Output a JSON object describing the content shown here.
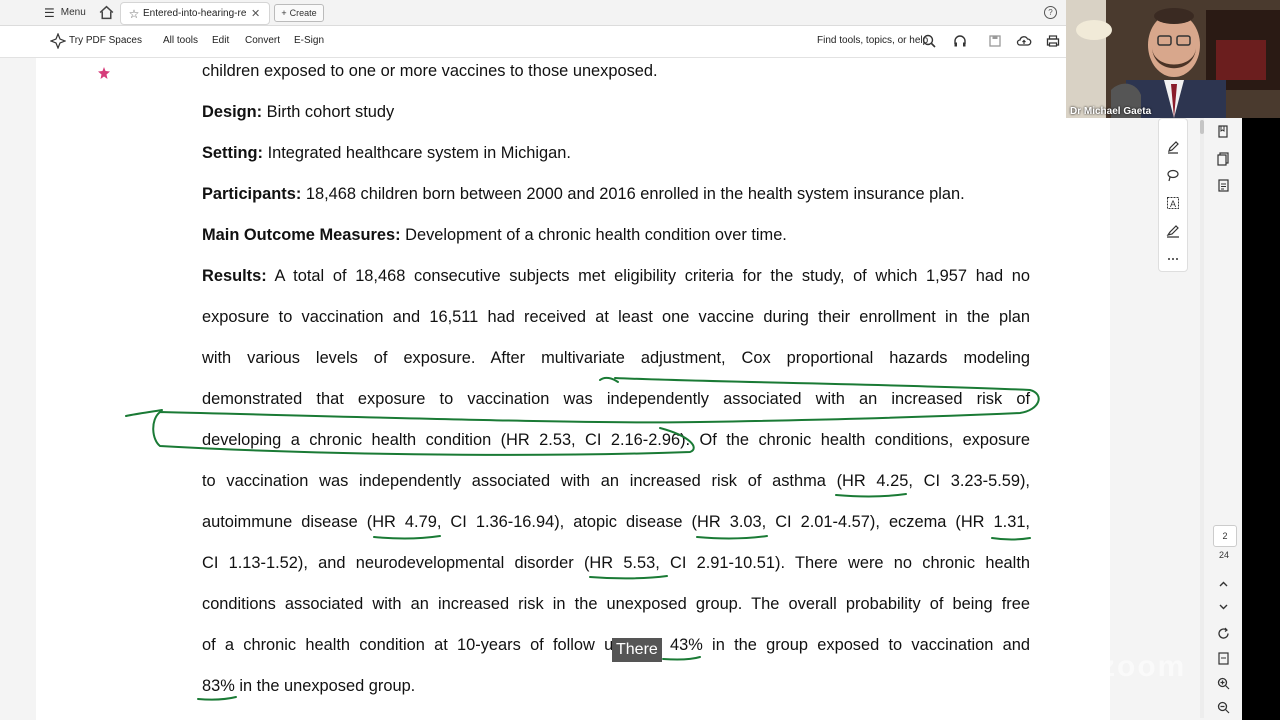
{
  "browser": {
    "menu_label": "Menu",
    "tab_title": "Entered-into-hearing-re...",
    "create_label": "Create",
    "help_icon": "?"
  },
  "toolbar": {
    "spaces_label": "Try PDF Spaces",
    "all_tools": "All tools",
    "edit": "Edit",
    "convert": "Convert",
    "esign": "E-Sign",
    "search_label": "Find tools, topics, or help"
  },
  "document": {
    "line_intro": "children exposed to one or more vaccines to those unexposed.",
    "design_label": "Design:",
    "design_text": " Birth cohort study",
    "setting_label": "Setting:",
    "setting_text": " Integrated healthcare system in Michigan.",
    "participants_label": "Participants:",
    "participants_text": " 18,468 children born between 2000 and 2016 enrolled in the health system insurance plan.",
    "outcome_label": "Main Outcome Measures:",
    "outcome_text": " Development of a chronic health condition over time.",
    "results_label": "Results:",
    "results_lines": [
      " A total of 18,468 consecutive subjects met eligibility criteria for the study, of which 1,957 had no",
      "exposure to vaccination and 16,511 had received at least one vaccine during their enrollment in the plan",
      "with various levels of exposure. After multivariate adjustment, Cox proportional hazards modeling",
      "demonstrated that exposure to vaccination was independently associated with an increased risk of",
      "developing a chronic health condition (HR 2.53, CI 2.16-2.96). Of the chronic health conditions, exposure",
      "to vaccination was independently associated with an increased risk of asthma (HR 4.25, CI 3.23-5.59),",
      "autoimmune disease (HR 4.79, CI 1.36-16.94), atopic disease (HR 3.03, CI 2.01-4.57), eczema (HR 1.31,",
      "CI 1.13-1.52), and neurodevelopmental disorder (HR 5.53, CI 2.91-10.51). There were no chronic health",
      "conditions associated with an increased risk in the unexposed group. The overall probability of being free",
      "of a chronic health condition at 10-years of follow up was 43% in the group exposed to vaccination and",
      "83% in the unexposed group."
    ]
  },
  "page_nav": {
    "current_page": "2",
    "total_pages": "24"
  },
  "video": {
    "participant_name": "Dr Michael Gaeta"
  },
  "caption": {
    "text": "There"
  },
  "colors": {
    "annotation_green": "#1a7a35",
    "pin_pink": "#d63c7a"
  }
}
